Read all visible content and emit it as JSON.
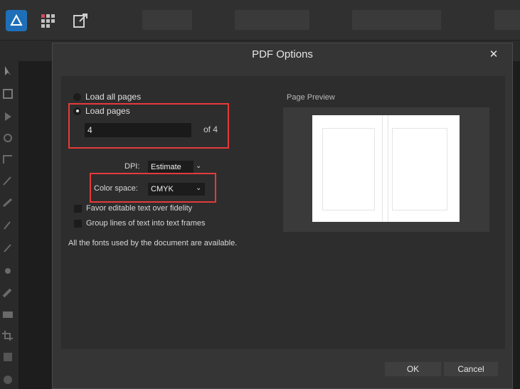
{
  "dialog": {
    "title": "PDF Options",
    "close_glyph": "✕"
  },
  "options": {
    "load_all_label": "Load all pages",
    "load_pages_label": "Load pages",
    "pages_value": "4",
    "of_label": "of 4",
    "dpi_label": "DPI:",
    "dpi_value": "Estimate",
    "color_space_label": "Color space:",
    "color_space_value": "CMYK",
    "favor_editable_label": "Favor editable text over fidelity",
    "group_lines_label": "Group lines of text into text frames",
    "fonts_note": "All the fonts used by the document are available."
  },
  "preview": {
    "title": "Page Preview"
  },
  "buttons": {
    "ok_label": "OK",
    "cancel_label": "Cancel"
  },
  "colors": {
    "highlight": "#e53a3a",
    "app_icon": "#1f6fb8"
  },
  "icons": [
    "affinity-app-icon",
    "grid-icon",
    "export-icon",
    "chevron-down-icon",
    "close-icon"
  ]
}
